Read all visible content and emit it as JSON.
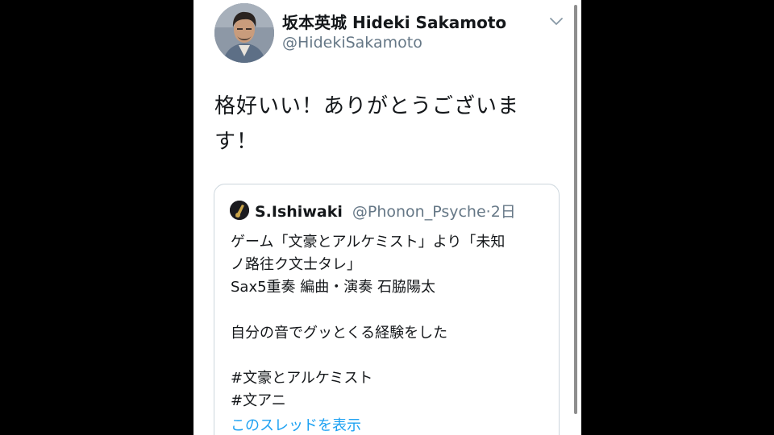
{
  "author": {
    "display_name": "坂本英城 Hideki Sakamoto",
    "handle": "@HidekiSakamoto",
    "avatar_icon": "profile-photo",
    "menu_icon": "chevron-down-icon"
  },
  "tweet": {
    "text": "格好いい！ありがとうございます！"
  },
  "quoted": {
    "name": "S.Ishiwaki",
    "handle": "@Phonon_Psyche",
    "separator": "·",
    "time": "2日",
    "lines": [
      "ゲーム「文豪とアルケミスト」より「未知",
      "ノ路往ク文士タレ」",
      "Sax5重奏 編曲・演奏 石脇陽太",
      "",
      "自分の音でグッとくる経験をした",
      "",
      "#文豪とアルケミスト",
      "#文アニ"
    ],
    "show_thread": "このスレッドを表示"
  },
  "colors": {
    "link": "#1da1f2",
    "secondary_text": "#657786",
    "border": "#ccd6dd",
    "letterbox": "#000000"
  }
}
